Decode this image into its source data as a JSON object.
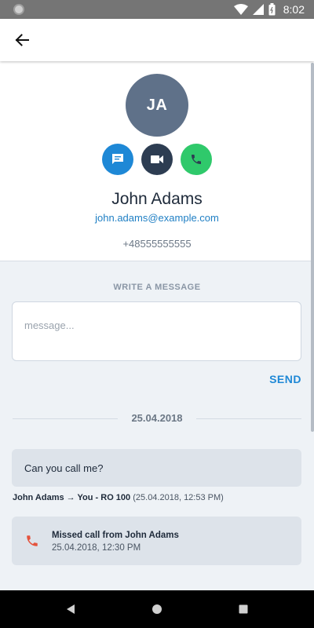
{
  "status_bar": {
    "time": "8:02",
    "icons": [
      "wifi-icon",
      "signal-icon",
      "battery-icon"
    ]
  },
  "app_bar": {
    "back_icon": "arrow-left-icon"
  },
  "contact": {
    "initials": "JA",
    "name": "John Adams",
    "email": "john.adams@example.com",
    "phone": "+48555555555",
    "avatar_color": "#5f7189",
    "actions": [
      {
        "name": "message",
        "icon": "chat-icon",
        "color": "#1e88d6"
      },
      {
        "name": "video",
        "icon": "video-icon",
        "color": "#2d3d52"
      },
      {
        "name": "call",
        "icon": "phone-icon",
        "color": "#2fc96b"
      }
    ]
  },
  "compose": {
    "label": "WRITE A MESSAGE",
    "placeholder": "message...",
    "value": "",
    "send_label": "SEND"
  },
  "history": {
    "date": "25.04.2018",
    "message": {
      "text": "Can you call me?",
      "from_to": "John Adams → You - RO 100",
      "time": "(25.04.2018, 12:53 PM)"
    },
    "call": {
      "title": "Missed call from John Adams",
      "time": "25.04.2018, 12:30 PM",
      "icon": "phone-missed-icon",
      "icon_color": "#e5533d"
    }
  },
  "nav_bar": {
    "buttons": [
      "back-triangle-icon",
      "home-circle-icon",
      "recents-square-icon"
    ]
  }
}
